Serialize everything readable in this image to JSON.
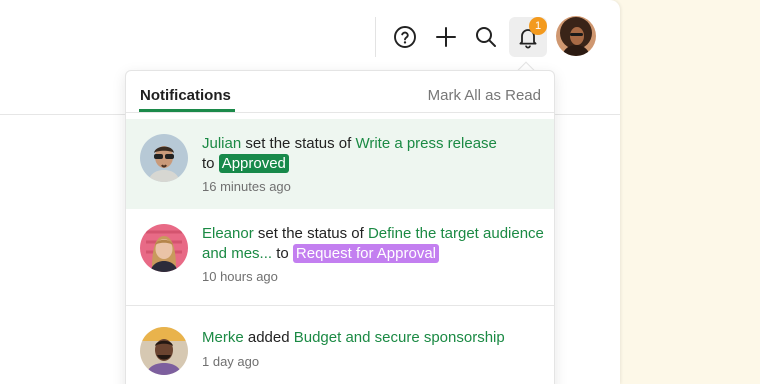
{
  "toolbar": {
    "help_icon": "help-circle-icon",
    "add_icon": "plus-icon",
    "search_icon": "search-icon",
    "bell_icon": "bell-icon",
    "badge_count": "1"
  },
  "panel": {
    "tab_label": "Notifications",
    "mark_all_label": "Mark All as Read"
  },
  "notifications": [
    {
      "actor": "Julian",
      "verb": " set the status of ",
      "task": "Write a press release",
      "connector": "to",
      "status": "Approved",
      "status_color": "#17894a",
      "time": "16 minutes ago",
      "unread": true
    },
    {
      "actor": "Eleanor",
      "verb": " set the status of ",
      "task": "Define the target audience and mes...",
      "connector": " to ",
      "status": "Request for Approval",
      "status_color": "#c37ff0",
      "time": "10 hours ago",
      "unread": false
    },
    {
      "actor": "Merke",
      "verb": " added ",
      "task": "Budget and secure sponsorship",
      "time": "1 day ago",
      "unread": false
    }
  ],
  "colors": {
    "accent_green": "#1b8a44",
    "badge_orange": "#f39a1e",
    "unread_bg": "#eef6f0"
  }
}
